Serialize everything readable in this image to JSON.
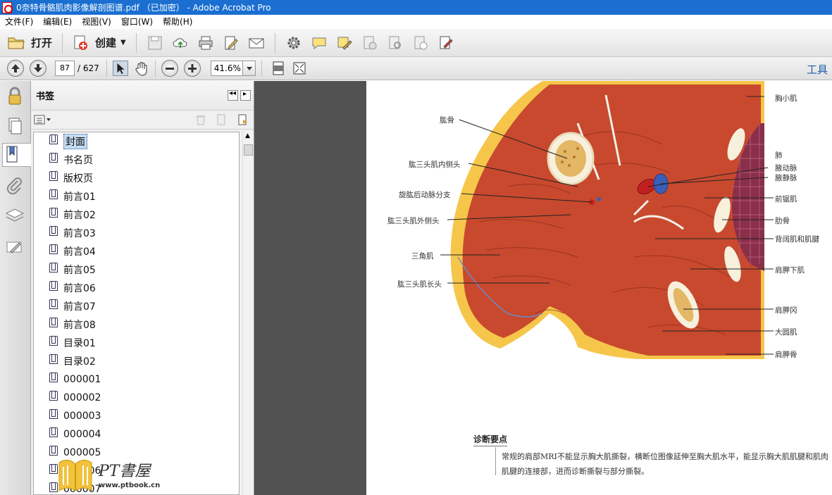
{
  "window": {
    "title": "0奈特骨骼肌肉影像解剖图谱.pdf （已加密） - Adobe Acrobat Pro"
  },
  "menu": [
    "文件(F)",
    "编辑(E)",
    "视图(V)",
    "窗口(W)",
    "帮助(H)"
  ],
  "toolbar": {
    "open_label": "打开",
    "create_label": "创建"
  },
  "nav": {
    "current_page": "87",
    "total_pages": "/ 627",
    "zoom": "41.6%",
    "tools_label": "工具"
  },
  "bookmarks": {
    "title": "书签",
    "items": [
      "封面",
      "书名页",
      "版权页",
      "前言01",
      "前言02",
      "前言03",
      "前言04",
      "前言05",
      "前言06",
      "前言07",
      "前言08",
      "目录01",
      "目录02",
      "000001",
      "000002",
      "000003",
      "000004",
      "000005",
      "000006",
      "000007"
    ]
  },
  "document": {
    "labels_left": [
      "肱骨",
      "肱三头肌内侧头",
      "旋肱后动脉分支",
      "肱三头肌外侧头",
      "三角肌",
      "肱三头肌长头"
    ],
    "labels_right": [
      "胸小肌",
      "肺",
      "腋动脉",
      "腋静脉",
      "前锯肌",
      "肋骨",
      "背阔肌和肌腱",
      "肩胛下肌",
      "肩胛冈",
      "大圆肌",
      "肩胛骨"
    ],
    "section_title": "诊断要点",
    "section_text": "常规的肩部MRI不能显示胸大肌撕裂，横断位图像延伸至胸大肌水平，能显示胸大肌肌腱和肌肉肌腱的连接部，进而诊断撕裂与部分撕裂。"
  },
  "watermark": {
    "brand": "PT書屋",
    "url": "www.ptbook.cn"
  }
}
